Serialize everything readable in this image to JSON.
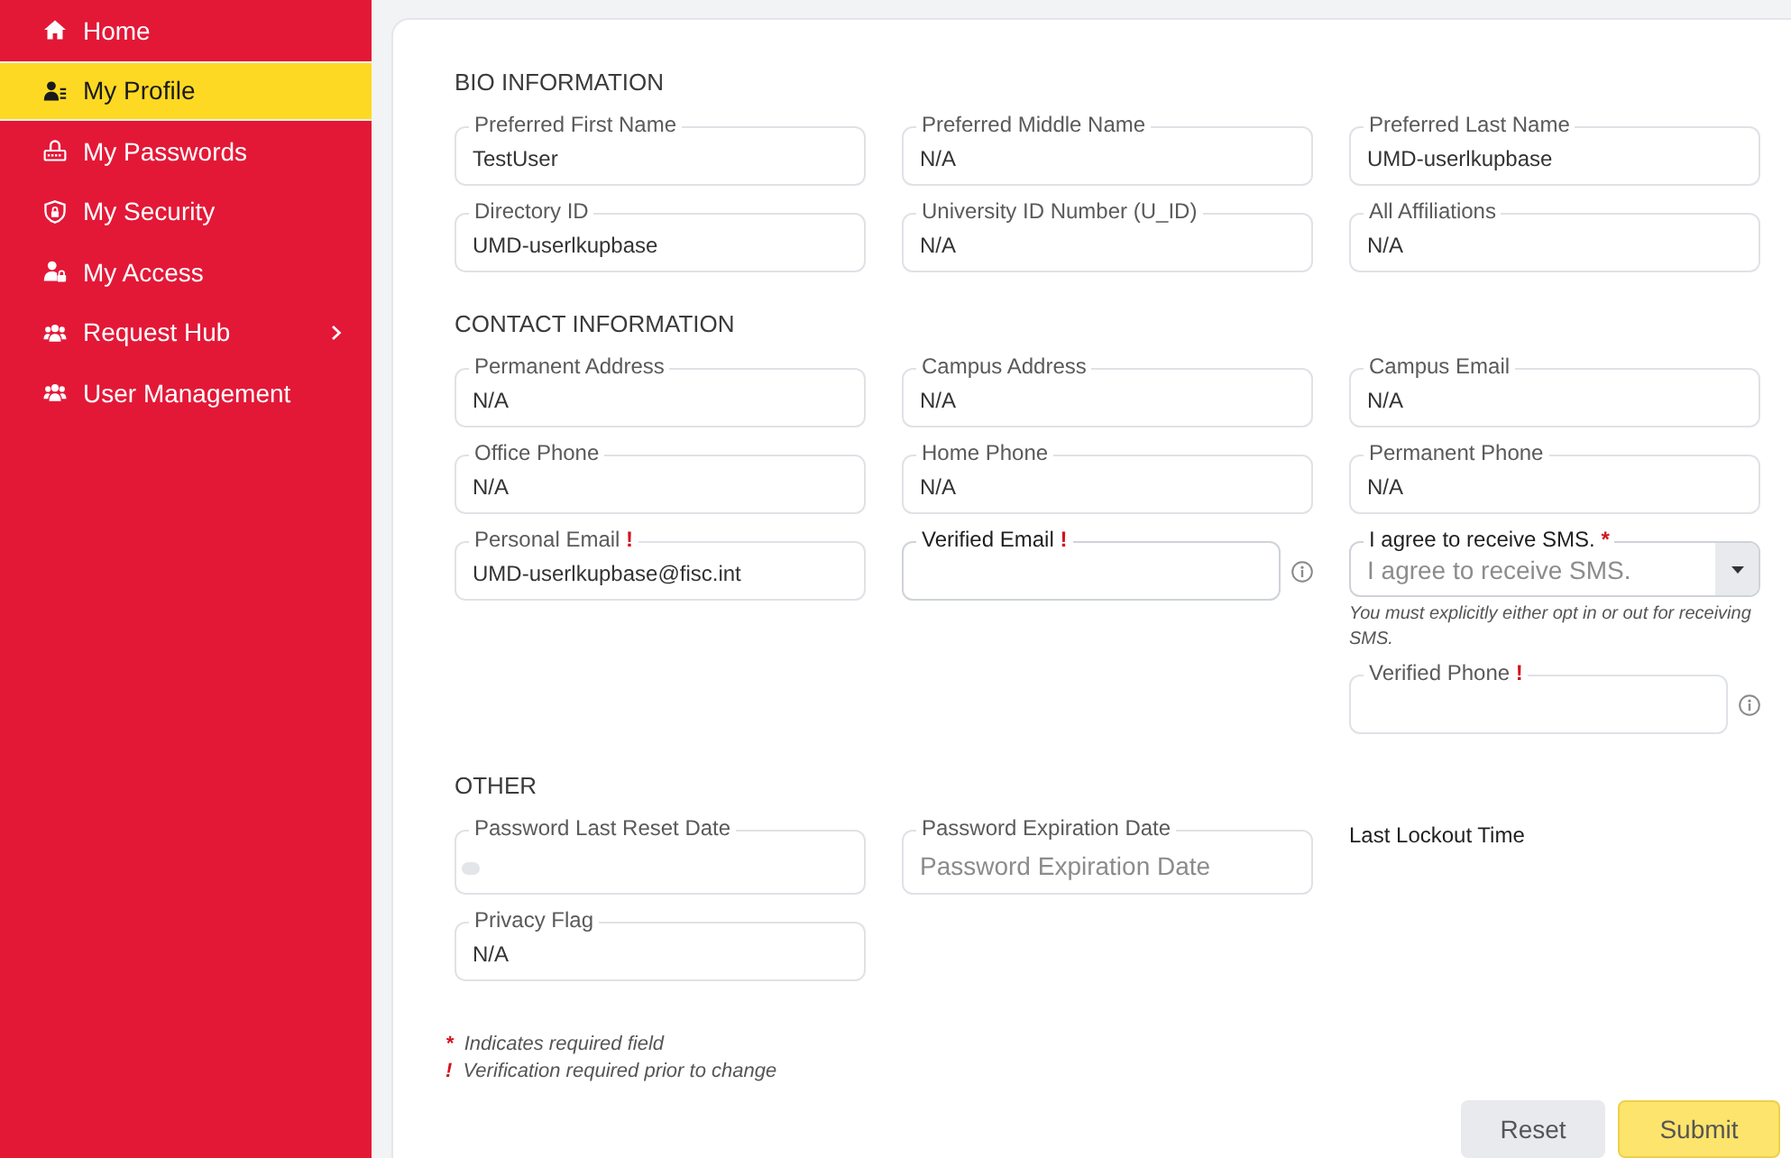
{
  "sidebar": {
    "items": [
      {
        "label": "Home",
        "kind": "link",
        "selected": false
      },
      {
        "label": "My Profile",
        "kind": "link",
        "selected": true
      },
      {
        "label": "My Passwords",
        "kind": "link",
        "selected": false
      },
      {
        "label": "My Security",
        "kind": "link",
        "selected": false
      },
      {
        "label": "My Access",
        "kind": "link",
        "selected": false
      },
      {
        "label": "Request Hub",
        "kind": "submenu",
        "selected": false
      },
      {
        "label": "User Management",
        "kind": "link",
        "selected": false
      }
    ]
  },
  "sections": [
    {
      "title": "BIO INFORMATION",
      "fields": [
        {
          "kind": "text",
          "label": "Preferred First Name",
          "value": "TestUser",
          "readonly": true,
          "info": false
        },
        {
          "kind": "text",
          "label": "Preferred Middle Name",
          "value": "N/A",
          "readonly": true,
          "info": false
        },
        {
          "kind": "text",
          "label": "Preferred Last Name",
          "value": "UMD-userlkupbase",
          "readonly": true,
          "info": false
        },
        {
          "kind": "text",
          "label": "Directory ID",
          "value": "UMD-userlkupbase",
          "readonly": true,
          "info": false
        },
        {
          "kind": "text",
          "label": "University ID Number (U_ID)",
          "value": "N/A",
          "readonly": true,
          "info": false
        },
        {
          "kind": "text",
          "label": "All Affiliations",
          "value": "N/A",
          "readonly": true,
          "info": false
        }
      ]
    },
    {
      "title": "CONTACT INFORMATION",
      "fields": [
        {
          "kind": "text",
          "label": "Permanent Address",
          "value": "N/A",
          "readonly": true,
          "info": false
        },
        {
          "kind": "text",
          "label": "Campus Address",
          "value": "N/A",
          "readonly": true,
          "info": false
        },
        {
          "kind": "text",
          "label": "Campus Email",
          "value": "N/A",
          "readonly": true,
          "info": false
        },
        {
          "kind": "text",
          "label": "Office Phone",
          "value": "N/A",
          "readonly": true,
          "info": false
        },
        {
          "kind": "text",
          "label": "Home Phone",
          "value": "N/A",
          "readonly": true,
          "info": false
        },
        {
          "kind": "text",
          "label": "Permanent Phone",
          "value": "N/A",
          "readonly": true,
          "info": false
        },
        {
          "kind": "text",
          "label": "Personal Email",
          "indicator": "!",
          "value": "UMD-userlkupbase@fisc.int",
          "readonly": true,
          "info": false
        },
        {
          "kind": "text",
          "label": "Verified Email",
          "indicator": "!",
          "readonly": false,
          "info": true
        },
        {
          "kind": "group",
          "fields": [
            {
              "kind": "select",
              "label": "I agree to receive SMS.",
              "indicator": "*",
              "placeholder": "I agree to receive SMS.",
              "hint": "You must explicitly either opt in or out for receiving SMS.",
              "readonly": false,
              "info": false
            },
            {
              "kind": "text",
              "label": "Verified Phone",
              "indicator": "!",
              "readonly": true,
              "info": true
            }
          ]
        }
      ]
    },
    {
      "title": "OTHER",
      "fields": [
        {
          "kind": "chip",
          "label": "Password Last Reset Date",
          "readonly": true,
          "info": false
        },
        {
          "kind": "text",
          "label": "Password Expiration Date",
          "placeholder": "Password Expiration Date",
          "readonly": true,
          "info": false
        },
        {
          "kind": "label",
          "label": "Last Lockout Time"
        },
        {
          "kind": "text",
          "label": "Privacy Flag",
          "value": "N/A",
          "readonly": true,
          "info": false
        }
      ]
    }
  ],
  "legend": [
    {
      "indicator": "*",
      "text": "Indicates required field"
    },
    {
      "indicator": "!",
      "text": "Verification required prior to change"
    }
  ],
  "buttons": [
    {
      "label": "Reset",
      "kind": "secondary"
    },
    {
      "label": "Submit",
      "kind": "primary"
    }
  ]
}
